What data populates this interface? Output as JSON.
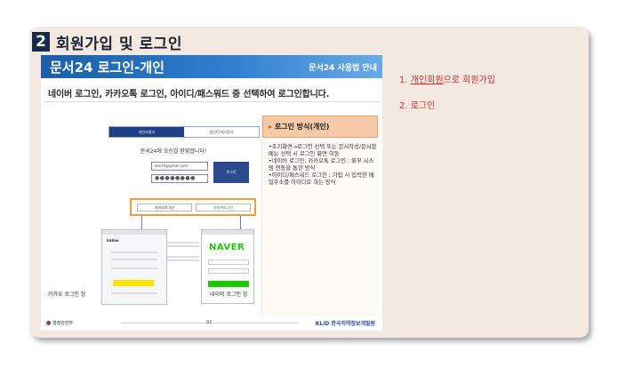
{
  "step": {
    "number": "2",
    "title": "회원가입 및 로그인"
  },
  "slide": {
    "header_title": "문서24 로그인-개인",
    "header_guide": "문서24 사용법 안내",
    "subtitle": "네이버 로그인, 카카오톡 로그인, 아이디/패스워드 중 선택하여 로그인합니다.",
    "tabs": [
      "개인사용자",
      "법인/단체사용자"
    ],
    "welcome": "문서24에 오신걸 환영합니다!",
    "login_id_value": "doc24@gmail.com",
    "login_pw_value": "●●●●●●●●",
    "login_button": "로그인",
    "kakao_button": "카카오로그인",
    "naver_button": "네이버로그인",
    "naver_logo": "NAVER",
    "kakao_logo": "kakao",
    "kakao_caption": "카카오 로그인 창",
    "naver_caption": "네이버 로그인 창",
    "info_title": "로그인 방식(개인)",
    "info_items": [
      "•초기화면→로그인 선택 또는 문서작성/문서함 메뉴 선택 시 로그인 화면 이동",
      "•네이버 로그인, 카카오톡 로그인 : 외부 시스템 연동을 통한 방식",
      "•아이디/패스워드 로그인 : 가입 시 입력한 메일주소를 아이디로 하는 방식"
    ],
    "footer_left": "행정안전부",
    "page_number": "02",
    "footer_right": "KLiD 한국지역정보개발원"
  },
  "steps": {
    "item1_prefix": "1. ",
    "item1_link": "개인회원",
    "item1_suffix": "으로 회원가입",
    "item2": "2. 로그인"
  },
  "colors": {
    "accent_red": "#e02b2b",
    "header_blue": "#1a5ea8",
    "card_bg": "#f3e9e0",
    "badge_navy": "#1a2b4a"
  }
}
